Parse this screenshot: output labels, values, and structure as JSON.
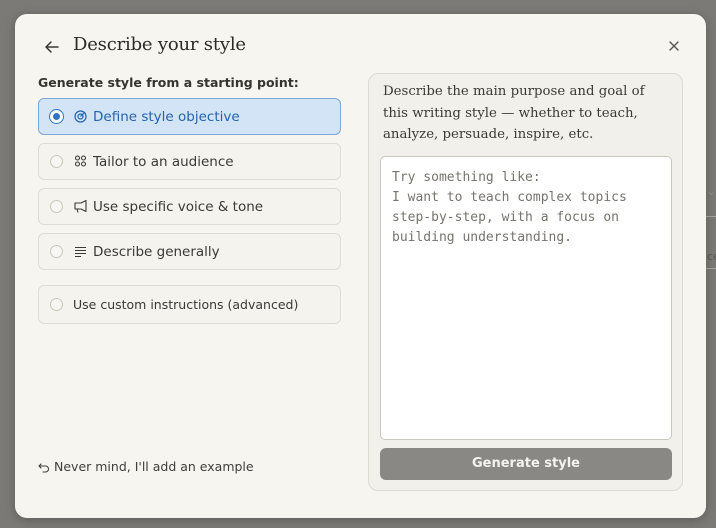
{
  "background": {
    "peek_text": "ce"
  },
  "modal": {
    "title": "Describe your style",
    "section_label": "Generate style from a starting point:",
    "options": [
      {
        "label": "Define style objective",
        "icon": "target-icon",
        "selected": true
      },
      {
        "label": "Tailor to an audience",
        "icon": "audience-icon",
        "selected": false
      },
      {
        "label": "Use specific voice & tone",
        "icon": "megaphone-icon",
        "selected": false
      },
      {
        "label": "Describe generally",
        "icon": "text-lines-icon",
        "selected": false
      },
      {
        "label": "Use custom instructions (advanced)",
        "icon": "",
        "selected": false
      }
    ],
    "nevermind_label": "Never mind, I'll add an example"
  },
  "panel": {
    "description": "Describe the main purpose and goal of this writing style — whether to teach, analyze, persuade, inspire, etc.",
    "textarea_placeholder": "Try something like:\nI want to teach complex topics step-by-step, with a focus on building understanding.",
    "generate_label": "Generate style"
  },
  "colors": {
    "accent": "#2f73c4",
    "selected_bg": "#d3e4f7",
    "button_bg": "#898884"
  }
}
